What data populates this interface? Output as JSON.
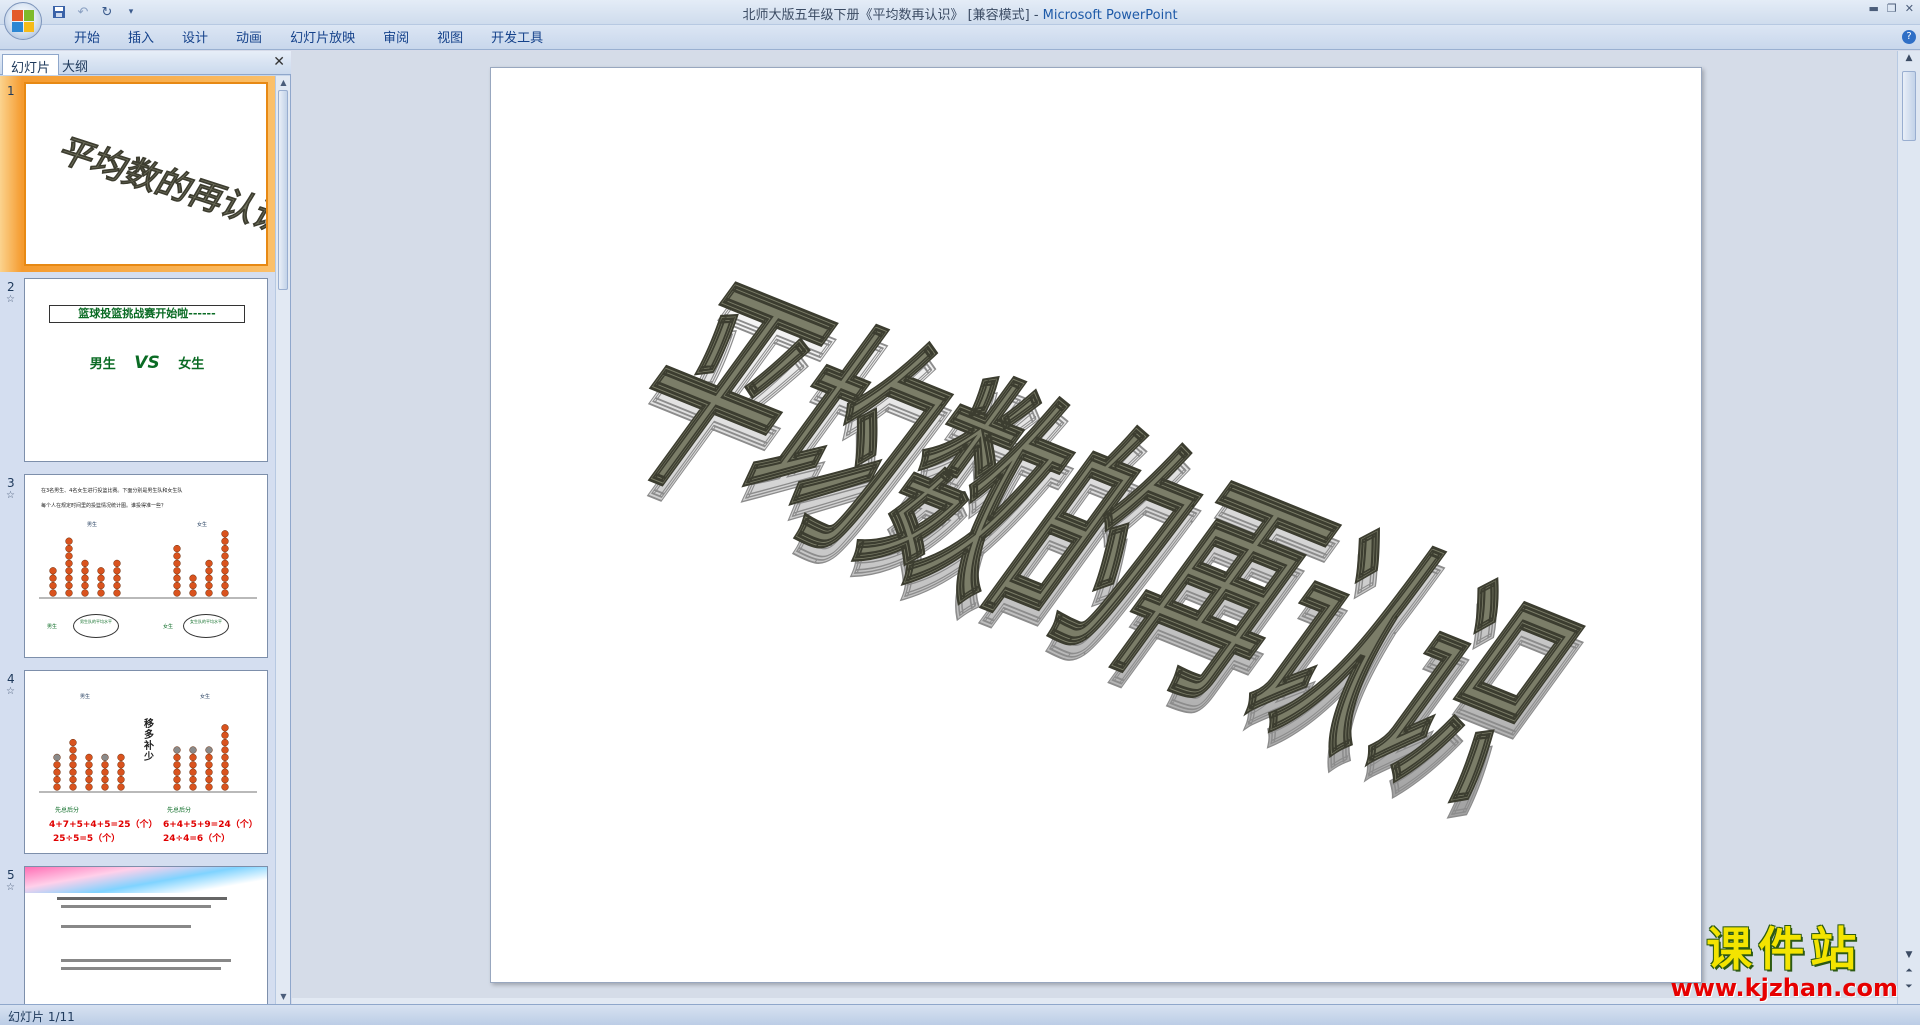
{
  "titlebar": {
    "title_doc": "北师大版五年级下册《平均数再认识》 [兼容模式] - ",
    "title_app": "Microsoft PowerPoint"
  },
  "ribbon": {
    "tabs": [
      "开始",
      "插入",
      "设计",
      "动画",
      "幻灯片放映",
      "审阅",
      "视图",
      "开发工具"
    ]
  },
  "left_pane": {
    "tab_slides": "幻灯片",
    "tab_outline": "大纲"
  },
  "slides": [
    {
      "num": "1",
      "title": "平均数的再认识"
    },
    {
      "num": "2",
      "banner": "篮球投篮挑战赛开始啦------",
      "boys": "男生",
      "vs": "VS",
      "girls": "女生"
    },
    {
      "num": "3",
      "line1": "在3名男生、4名女生进行投篮比赛。下面分别是男生队和女生队",
      "line2": "每个人在规定时间里的投篮情况统计图。谁投得准一些？",
      "label_boys": "男生",
      "label_girls": "女生",
      "team_boys": "男生",
      "team_girls": "女生",
      "bubble_boys": "男生队的平均水平",
      "bubble_girls": "女生队的平均水平"
    },
    {
      "num": "4",
      "label_boys": "男生",
      "label_girls": "女生",
      "vertical": "移多补少",
      "head_boys": "先总后分",
      "head_girls": "先总后分",
      "eq1_boys": "4+7+5+4+5=25（个）",
      "eq2_boys": "25÷5=5（个）",
      "eq1_girls": "6+4+5+9=24（个）",
      "eq2_girls": "24÷4=6（个）"
    },
    {
      "num": "5"
    }
  ],
  "main_slide": {
    "title": "平均数的再认识"
  },
  "status": {
    "slide_indicator": "幻灯片 1/11"
  },
  "watermark": {
    "text": "课件站",
    "url": "www.kjzhan.com"
  }
}
